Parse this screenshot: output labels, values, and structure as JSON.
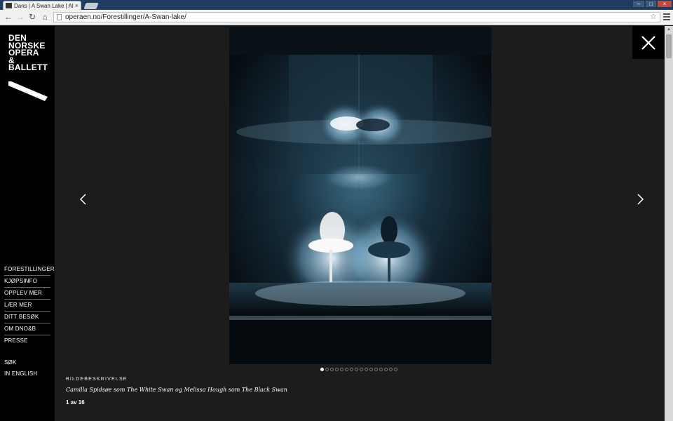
{
  "browser": {
    "tab_title": "Dans | A Swan Lake | Aliso",
    "tab_close": "×",
    "window_controls": [
      "–",
      "□",
      "×"
    ],
    "url": "operaen.no/Forestillinger/A-Swan-lake/",
    "star": "☆"
  },
  "logo": {
    "lines": [
      "DEN",
      "NORSKE",
      "OPERA",
      "&",
      "BALLETT"
    ]
  },
  "nav": {
    "items": [
      {
        "label": "FORESTILLINGER"
      },
      {
        "label": "KJØPSINFO"
      },
      {
        "label": "OPPLEV MER"
      },
      {
        "label": "LÆR MER"
      },
      {
        "label": "DITT BESØK"
      },
      {
        "label": "OM DNO&B"
      },
      {
        "label": "PRESSE"
      }
    ],
    "secondary": [
      {
        "label": "SØK"
      },
      {
        "label": "IN ENGLISH"
      }
    ]
  },
  "gallery": {
    "caption_label": "BILDEBESKRIVELSE",
    "caption": "Camilla Spidsøe som The White Swan og Melissa Hough som The Black Swan",
    "counter": "1 av 16",
    "total": 16,
    "current": 1
  },
  "colors": {
    "background": "#1c1c1c",
    "sidebar": "#000000",
    "accent": "#ffffff"
  }
}
